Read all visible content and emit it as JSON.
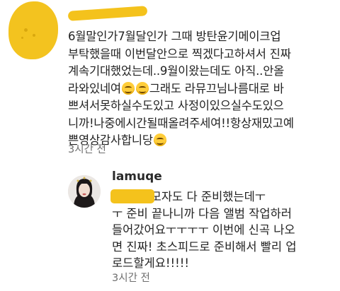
{
  "comment": {
    "lines": [
      "6월말인가7월달인가 그때 방탄윤기메이크업",
      "부탁했을때 이번달안으로 찍겠다고하셔서 진짜",
      "계속기대했었는데..9월이왔는데도 아직..안올",
      "라와있네여",
      "그래도 라뮤끄님나름대로 바",
      "쁘셔서못하실수도있고 사정이있으실수도있으",
      "니까!나중에시간될때올려주세여!!항상재밌고예",
      "쁜영상감사합니당"
    ],
    "time": "3시간 전"
  },
  "reply": {
    "username": "lamuqe",
    "text": "+         옷도 모자도 다 준비했는데ㅜ\nㅜ 준비 끝나니까 다음 앨범 작업하러\n들어갔어요ㅜㅜㅜㅜ 이번에 신곡 나오\n면 진짜! 초스피드로 준비해서 빨리 업\n로드할게요!!!!!",
    "time": "3시간 전"
  },
  "colors": {
    "redaction": "#f4c21c",
    "muted": "#6e6e6e"
  }
}
